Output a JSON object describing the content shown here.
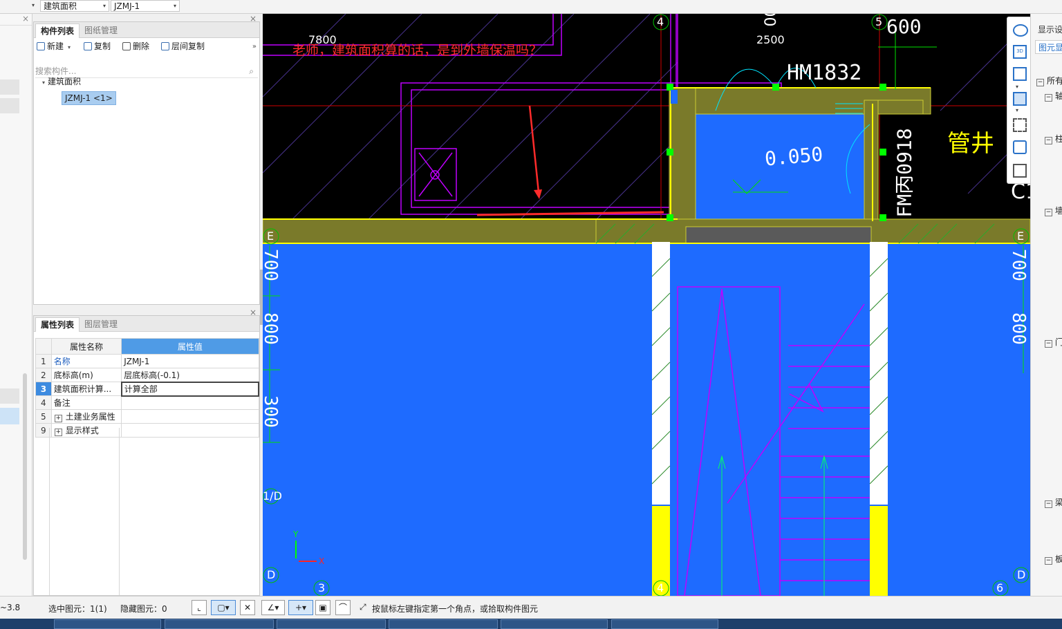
{
  "topbar": {
    "dropdown_type": "建筑面积",
    "dropdown_component": "JZMJ-1"
  },
  "component_panel": {
    "tabs": [
      "构件列表",
      "图纸管理"
    ],
    "toolbar": {
      "new_label": "新建",
      "copy_label": "复制",
      "delete_label": "删除",
      "floor_copy_label": "层间复制"
    },
    "search_placeholder": "搜索构件...",
    "tree": {
      "root_label": "建筑面积",
      "child_label": "JZMJ-1 <1>"
    }
  },
  "property_panel": {
    "tabs": [
      "属性列表",
      "图层管理"
    ],
    "header": {
      "name_col": "属性名称",
      "value_col": "属性值"
    },
    "rows": [
      {
        "num": "1",
        "name": "名称",
        "value": "JZMJ-1"
      },
      {
        "num": "2",
        "name": "底标高(m)",
        "value": "层底标高(-0.1)"
      },
      {
        "num": "3",
        "name": "建筑面积计算...",
        "value": "计算全部"
      },
      {
        "num": "4",
        "name": "备注",
        "value": ""
      },
      {
        "num": "5",
        "name": "土建业务属性",
        "value": ""
      },
      {
        "num": "9",
        "name": "显示样式",
        "value": ""
      }
    ]
  },
  "cad": {
    "annotation": "老师，建筑面积算的话，是到外墙保温吗？",
    "dim_7800": "7800",
    "dim_2500": "2500",
    "dim_600": "600",
    "dim_00": "00",
    "door_hm": "HM1832",
    "door_fm": "FM丙0918",
    "elevation": "0.050",
    "shaft_label": "管井",
    "c1_label": "C1",
    "dim_700": "700",
    "dim_800": "800",
    "dim_300": "300",
    "axis": [
      "4",
      "5",
      "E",
      "E",
      "1/D",
      "D",
      "D",
      "3",
      "6",
      "4"
    ],
    "axis_x": "X",
    "axis_y": "Y"
  },
  "right_panel": {
    "title": "显示设",
    "tab": "图元显",
    "items": [
      "所有",
      "轴",
      "柱",
      "墙",
      "门",
      "梁",
      "板"
    ]
  },
  "status": {
    "coord": "~3.8",
    "selected": "选中图元：1(1)",
    "hidden": "隐藏图元：0",
    "hint": "按鼠标左键指定第一个角点，或拾取构件图元"
  },
  "colors": {
    "cad_bg": "#000000",
    "floor_blue": "#1e6bff",
    "wall_olive": "#7a7a2a",
    "annotation_red": "#ff2b2b",
    "yellow_line": "#ffff00",
    "magenta_line": "#c000ff",
    "selection_green": "#00ff00"
  }
}
